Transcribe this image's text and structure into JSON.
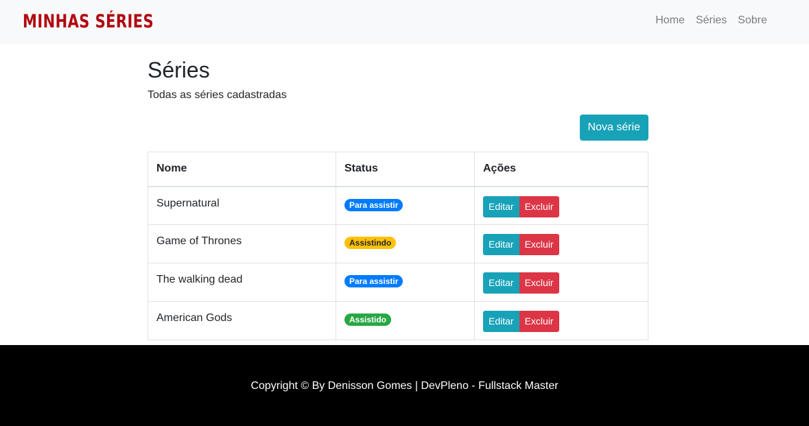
{
  "navbar": {
    "brand": "MINHAS SÉRIES",
    "brand_color": "#b20710",
    "links": [
      "Home",
      "Séries",
      "Sobre"
    ]
  },
  "page": {
    "title": "Séries",
    "subtitle": "Todas as séries cadastradas",
    "new_button": "Nova série"
  },
  "table": {
    "headers": [
      "Nome",
      "Status",
      "Ações"
    ],
    "rows": [
      {
        "name": "Supernatural",
        "status": "Para assistir",
        "status_color": "#007bff",
        "edit": "Editar",
        "delete": "Excluir"
      },
      {
        "name": "Game of Thrones",
        "status": "Assistindo",
        "status_color": "#ffc107",
        "edit": "Editar",
        "delete": "Excluir"
      },
      {
        "name": "The walking dead",
        "status": "Para assistir",
        "status_color": "#007bff",
        "edit": "Editar",
        "delete": "Excluir"
      },
      {
        "name": "American Gods",
        "status": "Assistido",
        "status_color": "#28a745",
        "edit": "Editar",
        "delete": "Excluir"
      }
    ]
  },
  "footer": {
    "text": "Copyright © By Denisson Gomes | DevPleno - Fullstack Master"
  }
}
